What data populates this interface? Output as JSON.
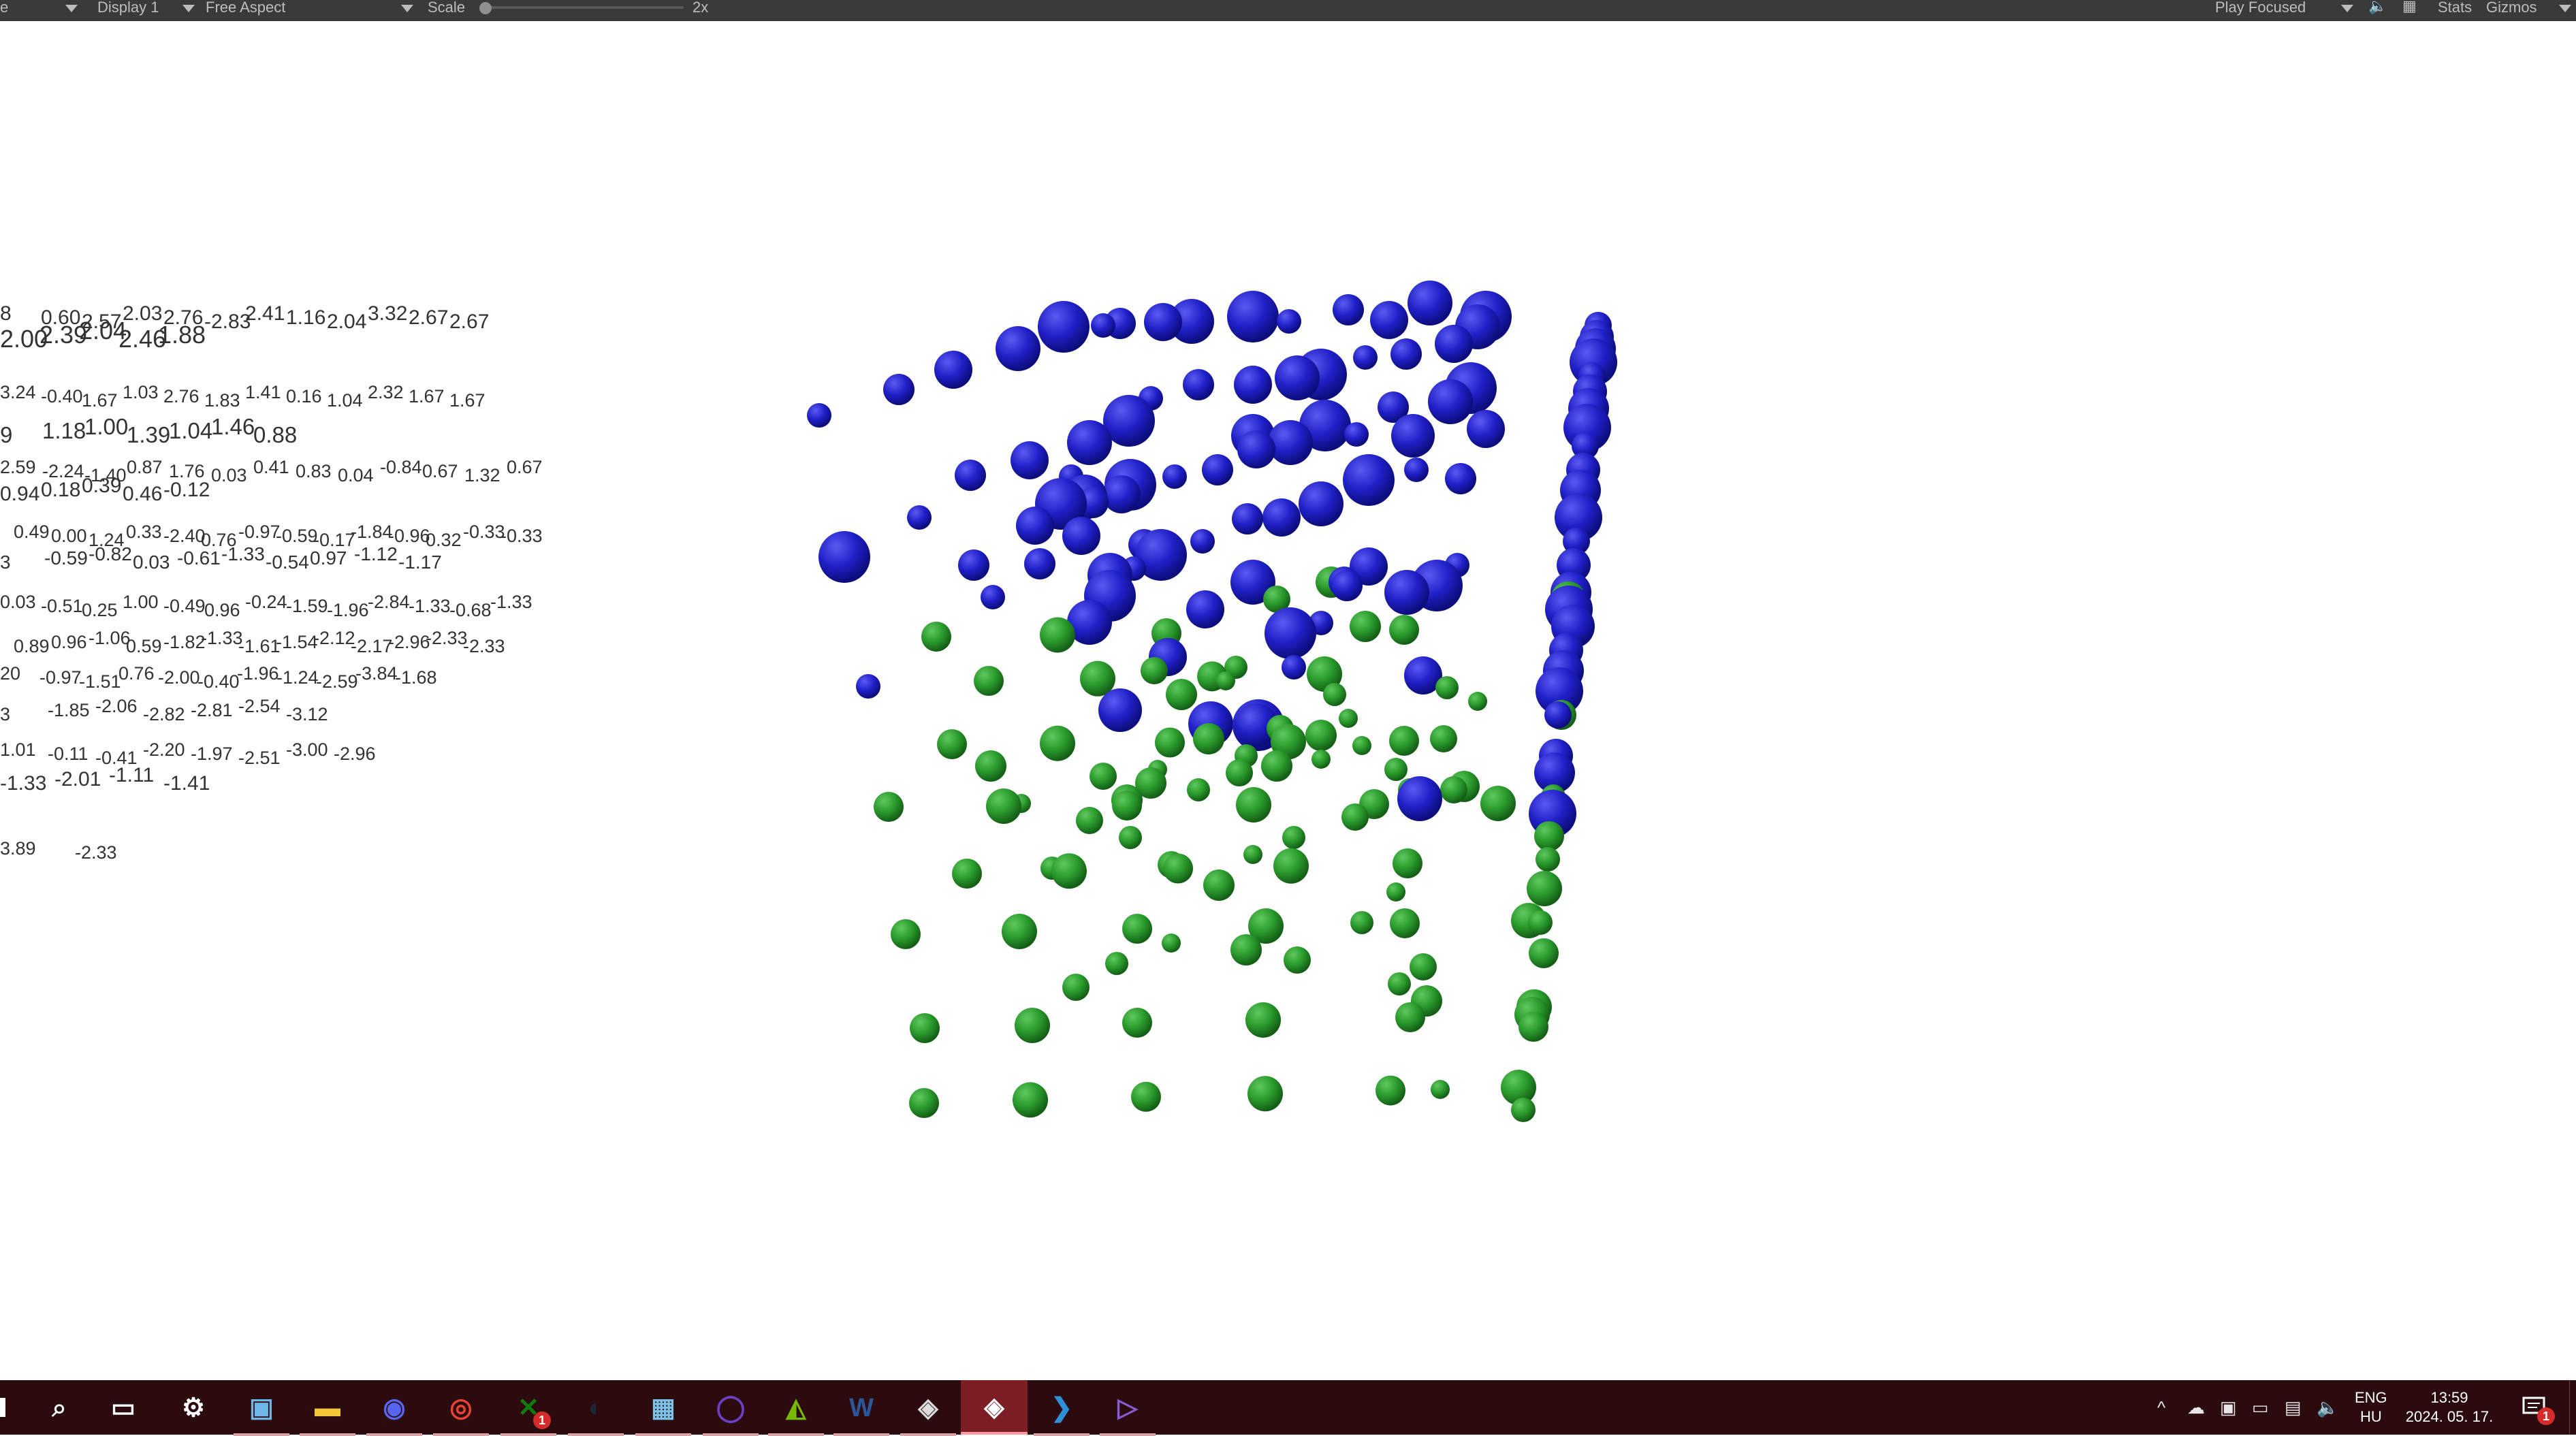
{
  "toolbar": {
    "game_tab_fragment": "e",
    "display": "Display 1",
    "aspect": "Free Aspect",
    "scale_label": "Scale",
    "scale_value": "2x",
    "play_mode": "Play Focused",
    "stats": "Stats",
    "gizmos": "Gizmos"
  },
  "scene": {
    "sphere_colors": {
      "blue": "#1e1ecc",
      "green": "#26992a"
    },
    "number_rows": [
      [
        "8",
        "0.60",
        "2.57",
        "2.03",
        "2.76",
        "-2.83",
        "2.41",
        "1.16",
        "2.04",
        "3.32",
        "2.67",
        "2.67"
      ],
      [
        "2.00",
        "2.39",
        "2.04",
        "2.46",
        "1.88"
      ],
      [
        "3.24",
        "-0.40",
        "1.67",
        "1.03",
        "2.76",
        "1.83",
        "1.41",
        "0.16",
        "1.04",
        "2.32",
        "1.67",
        "1.67"
      ],
      [
        "9",
        "1.18",
        "1.00",
        "1.39",
        "1.04",
        "1.46",
        "0.88"
      ],
      [
        "2.59",
        "-2.24",
        "-1.40",
        "0.87",
        "1.76",
        "0.03",
        "0.41",
        "0.83",
        "0.04",
        "-0.84",
        "0.67",
        "1.32",
        "0.67"
      ],
      [
        "0.94",
        "0.18",
        "0.39",
        "0.46",
        "-0.12"
      ],
      [
        "0.49",
        "0.00",
        "1.24",
        "0.33",
        "-2.40",
        "0.76",
        "-0.97",
        "-0.59",
        "-0.17",
        "-1.84",
        "-0.96",
        "0.32",
        "-0.33",
        "-0.33"
      ],
      [
        "3",
        "-0.59",
        "-0.82",
        "0.03",
        "-0.61",
        "-1.33",
        "-0.54",
        "0.97",
        "-1.12",
        "-1.17"
      ],
      [
        "0.03",
        "-0.51",
        "0.25",
        "1.00",
        "-0.49",
        "0.96",
        "-0.24",
        "-1.59",
        "-1.96",
        "-2.84",
        "-1.33",
        "-0.68",
        "-1.33"
      ],
      [
        "0.89",
        "0.96",
        "-1.06",
        "0.59",
        "-1.82",
        "-1.33",
        "-1.61",
        "-1.54",
        "-2.12",
        "-2.17",
        "-2.96",
        "-2.33",
        "-2.33"
      ],
      [
        "20",
        "-0.97",
        "-1.51",
        "0.76",
        "-2.00",
        "-0.40",
        "-1.96",
        "-1.24",
        "-2.59",
        "-3.84",
        "-1.68"
      ],
      [
        "3",
        "-1.85",
        "-2.06",
        "-2.82",
        "-2.81",
        "-2.54",
        "-3.12"
      ],
      [
        "1.01",
        "-0.11",
        "-0.41",
        "-2.20",
        "-1.97",
        "-2.51",
        "-3.00",
        "-2.96"
      ],
      [
        "-1.33",
        "-2.01",
        "-1.11",
        "-1.41"
      ],
      [
        "3.89",
        "-2.33"
      ]
    ]
  },
  "taskbar": {
    "apps": [
      {
        "name": "search-icon",
        "glyph": "⌕"
      },
      {
        "name": "task-view-icon",
        "glyph": "▭"
      },
      {
        "name": "settings-app-icon",
        "glyph": "⚙"
      },
      {
        "name": "control-panel-icon",
        "glyph": "▣"
      },
      {
        "name": "file-explorer-icon",
        "glyph": "▬"
      },
      {
        "name": "discord-icon",
        "glyph": "◉"
      },
      {
        "name": "chrome-icon",
        "glyph": "◎"
      },
      {
        "name": "xbox-icon",
        "glyph": "✕",
        "badge": "1"
      },
      {
        "name": "steam-icon",
        "glyph": "◐"
      },
      {
        "name": "calculator-icon",
        "glyph": "▦"
      },
      {
        "name": "github-desktop-icon",
        "glyph": "◯"
      },
      {
        "name": "nvidia-icon",
        "glyph": "◭"
      },
      {
        "name": "word-icon",
        "glyph": "W"
      },
      {
        "name": "unity-hub-icon",
        "glyph": "◈"
      },
      {
        "name": "unity-editor-icon",
        "glyph": "◈"
      },
      {
        "name": "vscode-icon",
        "glyph": "❯"
      },
      {
        "name": "visual-studio-icon",
        "glyph": "▷"
      }
    ],
    "tray": {
      "chevron": "^",
      "language": "ENG",
      "region": "HU",
      "time": "13:59",
      "date": "2024. 05. 17.",
      "notification_badge": "1"
    }
  }
}
